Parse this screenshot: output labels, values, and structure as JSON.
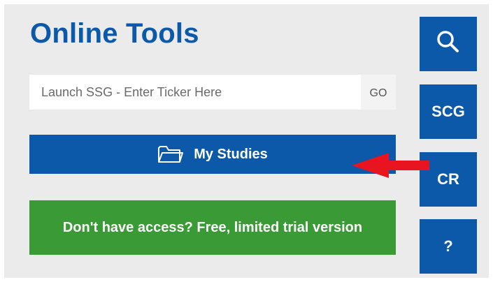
{
  "header": {
    "title": "Online Tools"
  },
  "search": {
    "placeholder": "Launch SSG - Enter Ticker Here",
    "go_label": "GO"
  },
  "studies_button": {
    "label": "My Studies",
    "icon": "folder-icon"
  },
  "trial_button": {
    "label": "Don't have access? Free, limited trial version"
  },
  "side_buttons": [
    {
      "icon": "search-icon",
      "label": ""
    },
    {
      "label": "SCG"
    },
    {
      "label": "CR"
    },
    {
      "label": "?"
    }
  ],
  "colors": {
    "brand_blue": "#0b59a8",
    "trial_green": "#3a9a35",
    "panel_bg": "#ebebeb",
    "annotation_arrow": "#e8141f"
  }
}
